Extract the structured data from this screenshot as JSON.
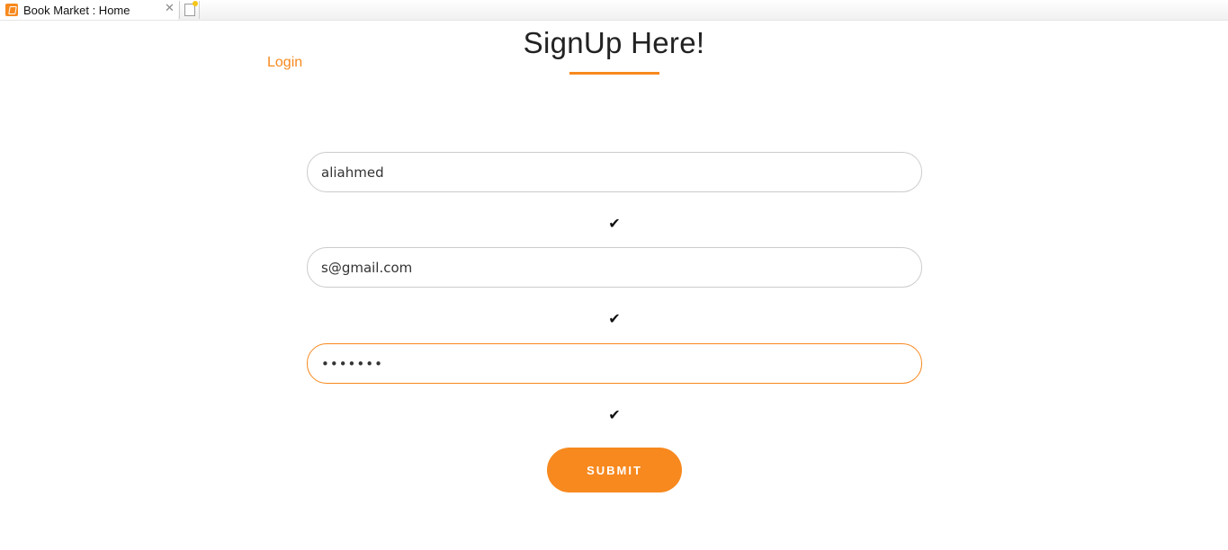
{
  "browser": {
    "tab_title": "Book Market : Home",
    "tab_close_glyph": "✕",
    "favicon_icon": "book-icon",
    "new_tab_icon": "new-page-icon"
  },
  "nav": {
    "login_label": "Login"
  },
  "form": {
    "title": "SignUp Here!",
    "username_value": "aliahmed",
    "email_value": "s@gmail.com",
    "password_value": "•••••••",
    "check_glyph": "✔",
    "submit_label": "SUBMIT"
  },
  "colors": {
    "accent": "#f7891e",
    "field_border": "#cccccc",
    "text": "#222222"
  }
}
